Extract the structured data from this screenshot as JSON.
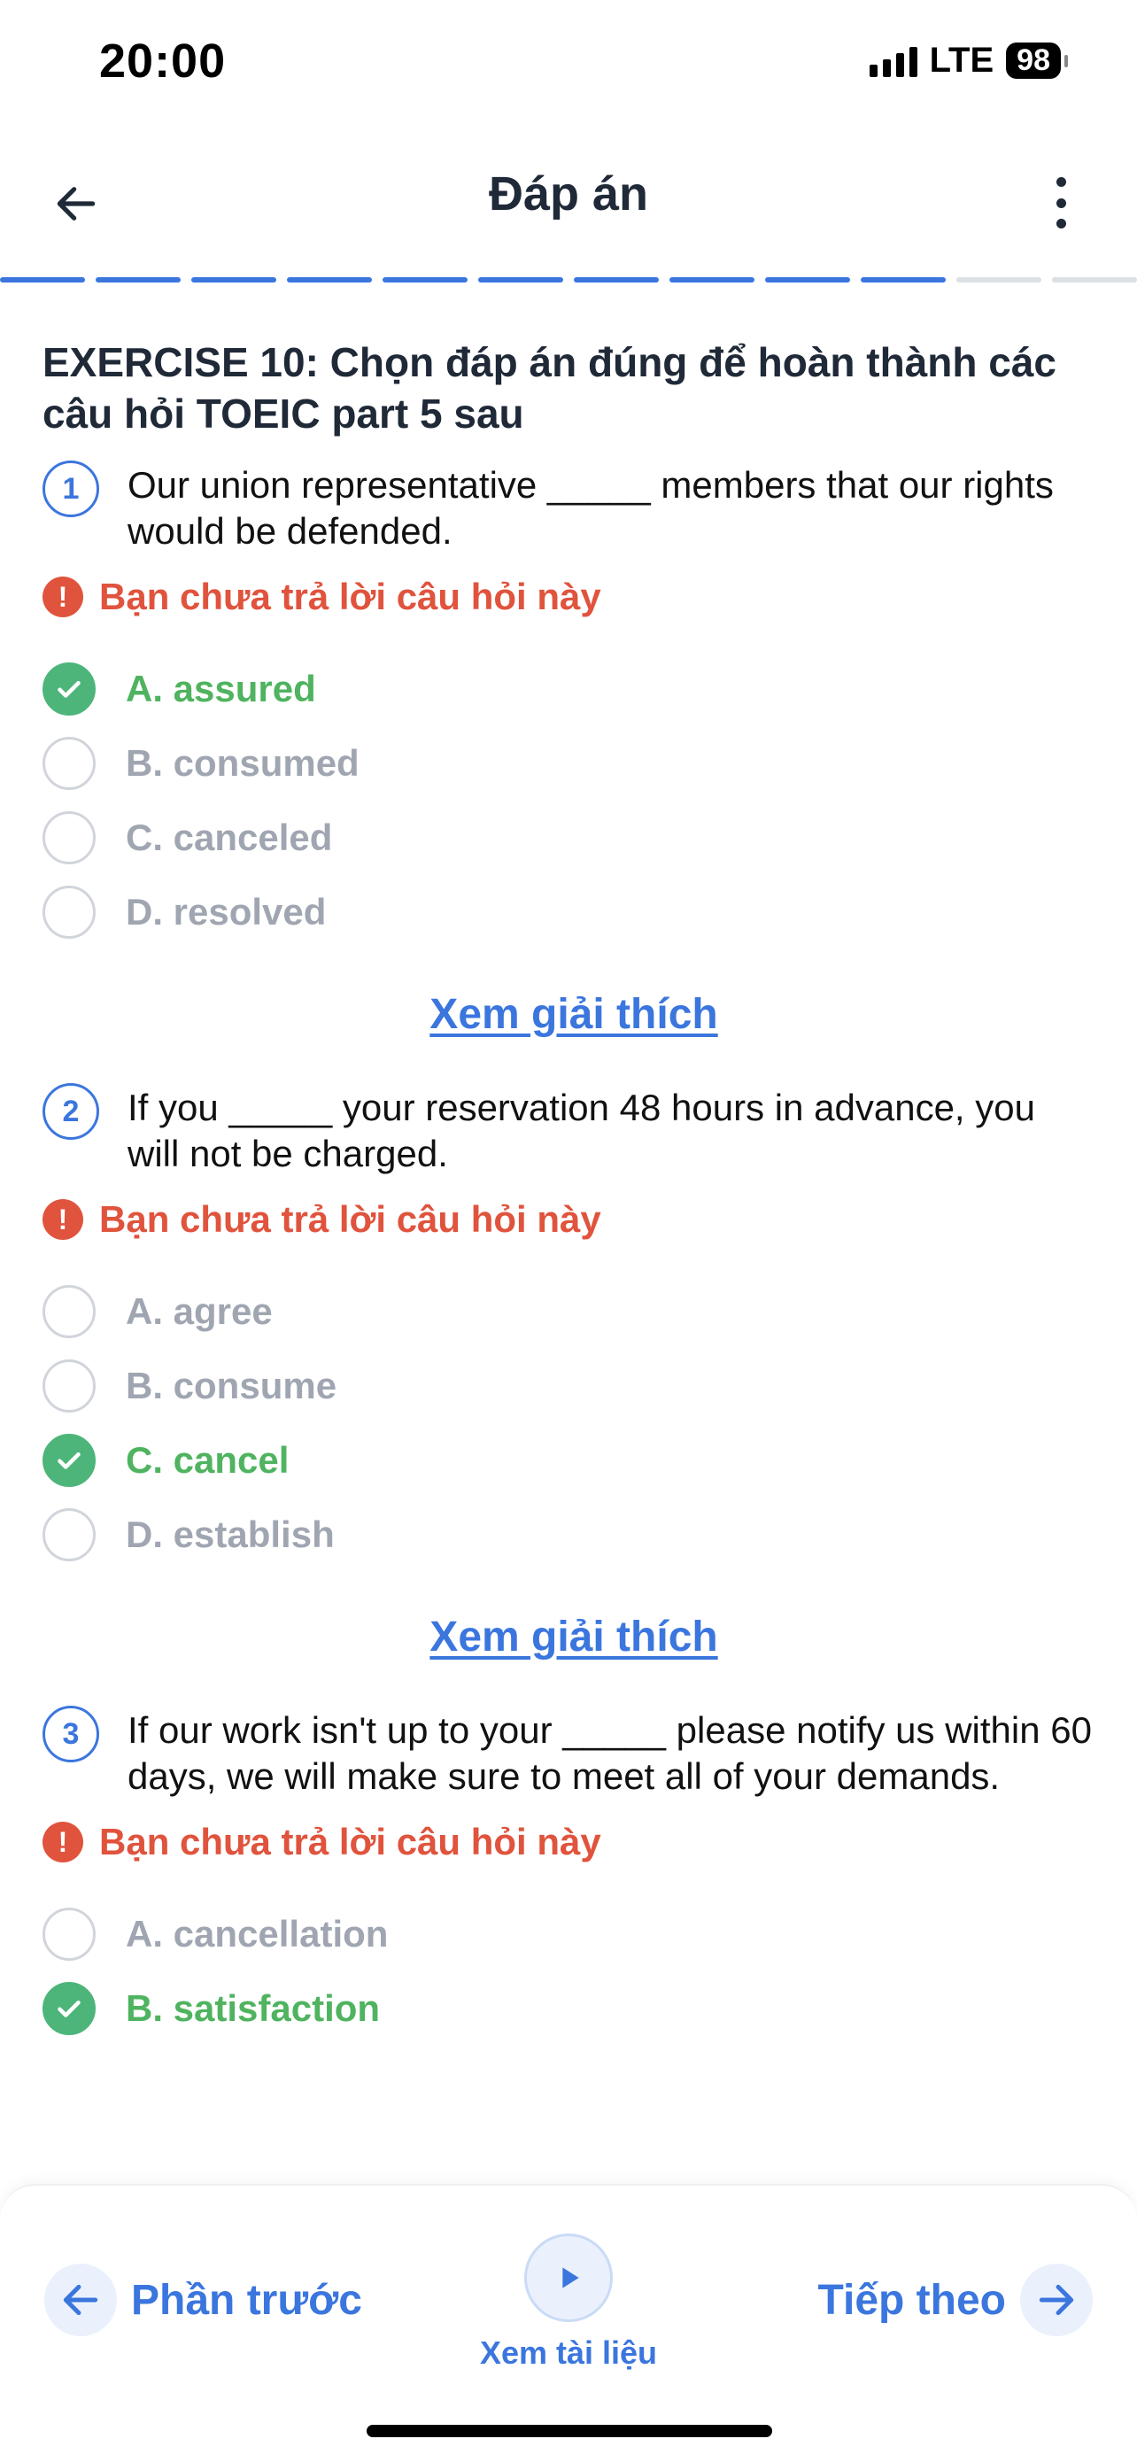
{
  "status_bar": {
    "time": "20:00",
    "network": "LTE",
    "battery": "98"
  },
  "header": {
    "title": "Đáp án",
    "back_icon": "arrow-left-icon",
    "more_icon": "more-vertical-icon"
  },
  "progress": {
    "total_segments": 12,
    "completed_segments": 10
  },
  "exercise": {
    "title": "EXERCISE 10: Chọn đáp án đúng để hoàn thành các câu hỏi TOEIC part 5 sau"
  },
  "questions": [
    {
      "number": "1",
      "text": "Our union representative _____ members that our rights would be defended.",
      "warning": "Bạn chưa trả lời câu hỏi này",
      "options": [
        {
          "label": "A. assured",
          "correct": true
        },
        {
          "label": "B. consumed",
          "correct": false
        },
        {
          "label": "C. canceled",
          "correct": false
        },
        {
          "label": "D. resolved",
          "correct": false
        }
      ],
      "explain_label": "Xem giải thích"
    },
    {
      "number": "2",
      "text": "If you _____ your reservation 48 hours in advance, you will not be charged.",
      "warning": "Bạn chưa trả lời câu hỏi này",
      "options": [
        {
          "label": "A. agree",
          "correct": false
        },
        {
          "label": "B. consume",
          "correct": false
        },
        {
          "label": "C. cancel",
          "correct": true
        },
        {
          "label": "D. establish",
          "correct": false
        }
      ],
      "explain_label": "Xem giải thích"
    },
    {
      "number": "3",
      "text": "If our work isn't up to your _____  please notify us within 60 days, we will make sure to meet all of your demands.",
      "warning": "Bạn chưa trả lời câu hỏi này",
      "options": [
        {
          "label": "A. cancellation",
          "correct": false
        },
        {
          "label": "B. satisfaction",
          "correct": true
        }
      ]
    }
  ],
  "bottom_bar": {
    "prev_label": "Phần trước",
    "next_label": "Tiếp theo",
    "doc_label": "Xem tài liệu"
  },
  "colors": {
    "accent": "#3b76de",
    "correct": "#4fb35f",
    "warning": "#e0533d",
    "muted": "#a0a6b1"
  }
}
